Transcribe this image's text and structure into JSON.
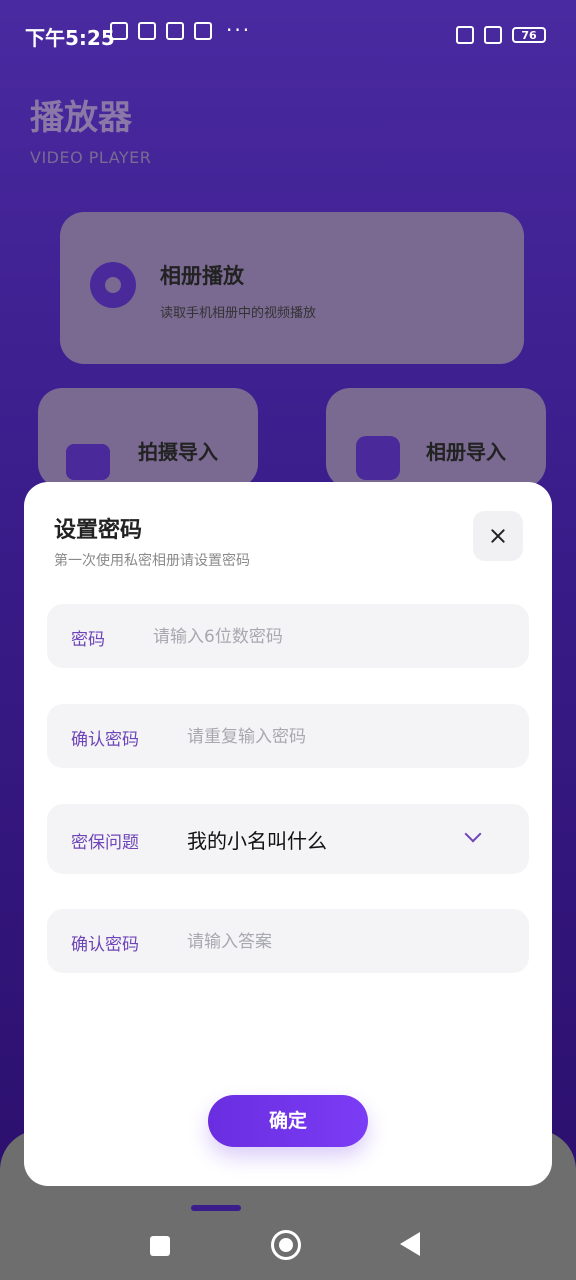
{
  "status_bar": {
    "time": "下午5:25",
    "more": "···",
    "battery": "76"
  },
  "header": {
    "title": "播放器",
    "subtitle": "VIDEO PLAYER"
  },
  "cards": {
    "album_play": {
      "title": "相册播放",
      "desc": "读取手机相册中的视频播放"
    },
    "shoot_import": {
      "title": "拍摄导入"
    },
    "album_import": {
      "title": "相册导入"
    }
  },
  "modal": {
    "title": "设置密码",
    "subtitle": "第一次使用私密相册请设置密码",
    "fields": {
      "password": {
        "label": "密码",
        "placeholder": "请输入6位数密码"
      },
      "confirm_password": {
        "label": "确认密码",
        "placeholder": "请重复输入密码"
      },
      "security_question": {
        "label": "密保问题",
        "value": "我的小名叫什么"
      },
      "answer": {
        "label": "确认密码",
        "placeholder": "请输入答案"
      }
    },
    "confirm_label": "确定"
  },
  "colors": {
    "accent": "#6e45b8",
    "button": "#7b3cf5",
    "background": "#3a1c8a"
  }
}
